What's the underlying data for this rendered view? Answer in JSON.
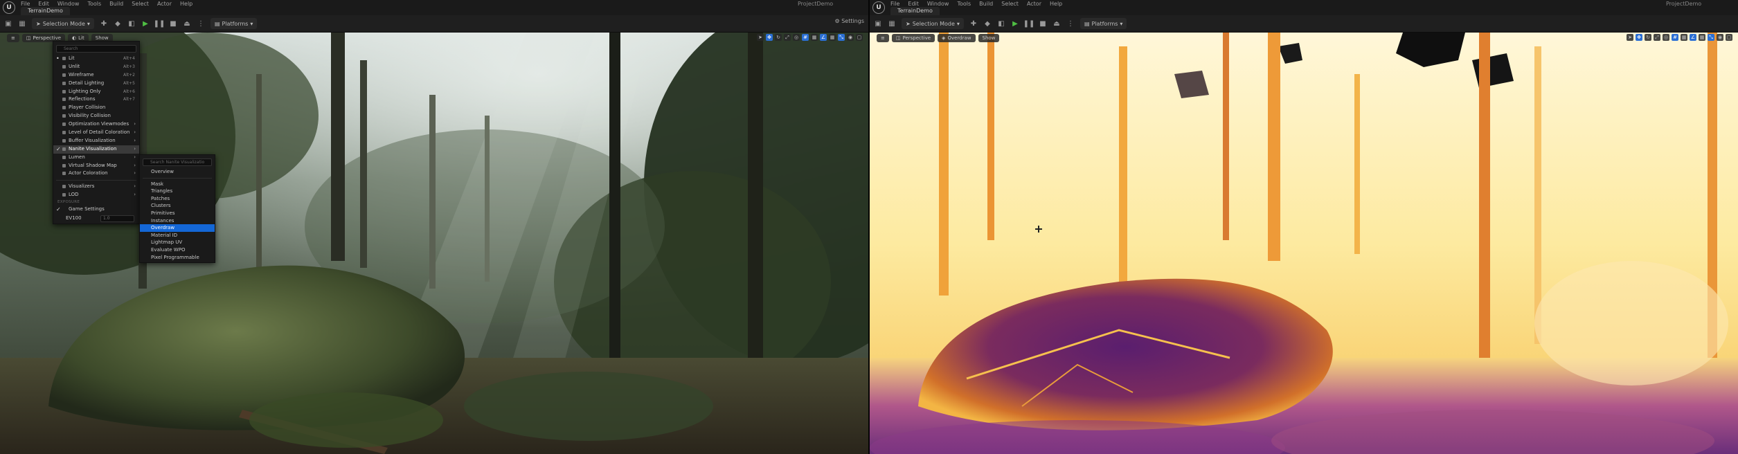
{
  "menubar": [
    "File",
    "Edit",
    "Window",
    "Tools",
    "Build",
    "Select",
    "Actor",
    "Help"
  ],
  "left_editor": {
    "project_tab": "TerrainDemo",
    "title_project": "ProjectDemo",
    "toolbar": {
      "selection_mode": "Selection Mode",
      "platforms": "Platforms",
      "settings": "Settings"
    },
    "viewport": {
      "perspective": "Perspective",
      "view_mode": "Lit",
      "show": "Show"
    }
  },
  "right_editor": {
    "project_tab": "TerrainDemo",
    "title_project": "ProjectDemo",
    "toolbar": {
      "selection_mode": "Selection Mode",
      "platforms": "Platforms"
    },
    "viewport": {
      "perspective": "Perspective",
      "view_mode": "Overdraw",
      "show": "Show"
    }
  },
  "view_mode_menu": {
    "search_placeholder": "Search",
    "items": [
      {
        "label": "Lit",
        "shortcut": "Alt+4",
        "checked": true
      },
      {
        "label": "Unlit",
        "shortcut": "Alt+3"
      },
      {
        "label": "Wireframe",
        "shortcut": "Alt+2"
      },
      {
        "label": "Detail Lighting",
        "shortcut": "Alt+5"
      },
      {
        "label": "Lighting Only",
        "shortcut": "Alt+6"
      },
      {
        "label": "Reflections",
        "shortcut": "Alt+7"
      },
      {
        "label": "Player Collision"
      },
      {
        "label": "Visibility Collision"
      },
      {
        "label": "Optimization Viewmodes",
        "submenu": true
      },
      {
        "label": "Level of Detail Coloration",
        "submenu": true
      },
      {
        "label": "Buffer Visualization",
        "submenu": true
      },
      {
        "label": "Nanite Visualization",
        "submenu": true,
        "highlighted": true
      },
      {
        "label": "Lumen",
        "submenu": true
      },
      {
        "label": "Virtual Shadow Map",
        "submenu": true
      },
      {
        "label": "Actor Coloration",
        "submenu": true
      }
    ],
    "group2": [
      {
        "label": "Visualizers",
        "submenu": true
      },
      {
        "label": "LOD",
        "submenu": true
      }
    ],
    "exposure_section": "EXPOSURE",
    "game_settings": "Game Settings",
    "ev100_label": "EV100",
    "ev100_value": "1.0"
  },
  "nanite_submenu": {
    "search_placeholder": "Search Nanite Visualizatio",
    "items": [
      "Overview",
      "Mask",
      "Triangles",
      "Patches",
      "Clusters",
      "Primitives",
      "Instances",
      "Overdraw",
      "Material ID",
      "Lightmap UV",
      "Evaluate WPO",
      "Pixel Programmable"
    ],
    "selected": "Overdraw"
  },
  "colors": {
    "accent_blue": "#1467d6",
    "play_green": "#4fbf43"
  }
}
